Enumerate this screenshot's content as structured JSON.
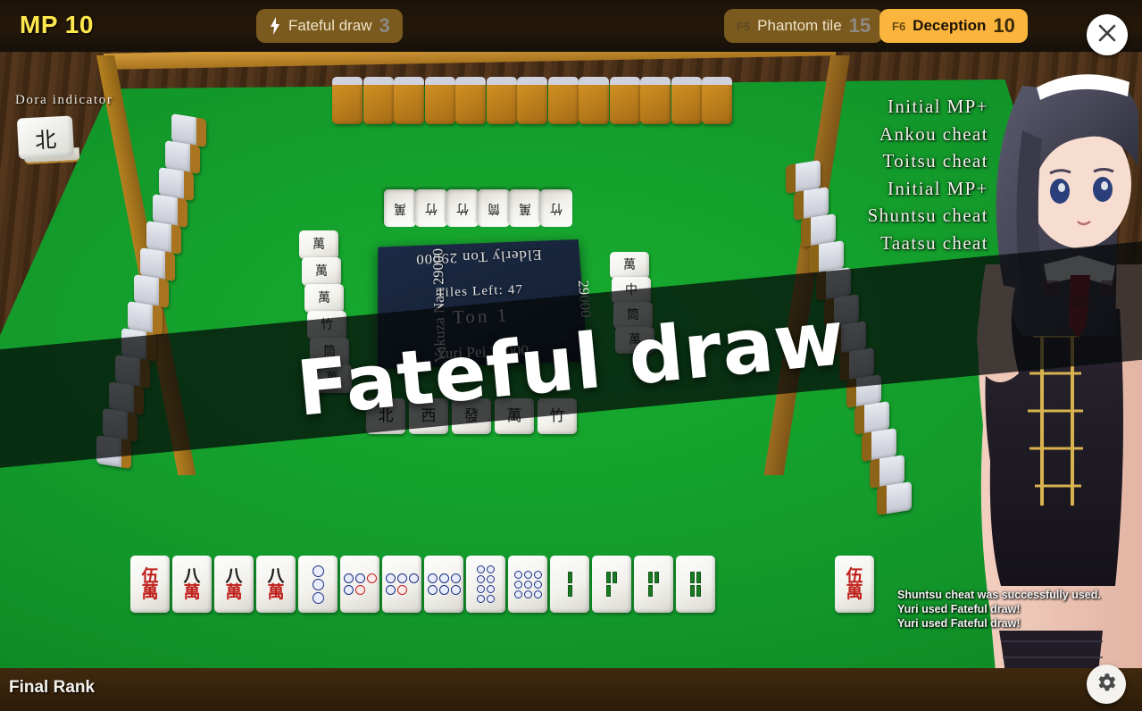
{
  "topbar": {
    "mp_label": "MP 10",
    "skills": [
      {
        "key": "",
        "name": "Fateful draw",
        "count": "3",
        "state": "dim",
        "icon": "lightning-bolt-icon"
      },
      {
        "key": "F5",
        "name": "Phantom tile",
        "count": "15",
        "state": "dim",
        "icon": ""
      },
      {
        "key": "F6",
        "name": "Deception",
        "count": "10",
        "state": "lit",
        "icon": ""
      }
    ],
    "close_icon": "close-icon"
  },
  "cheat_list": [
    "Initial MP+",
    "Ankou cheat",
    "Toitsu cheat",
    "Initial MP+",
    "Shuntsu cheat",
    "Taatsu cheat"
  ],
  "dora": {
    "label": "Dora indicator",
    "tile": "北"
  },
  "center_panel": {
    "top_player": "Elderly  Ton  29000",
    "left_player": "Yakuza  Nan  29000",
    "right_player": "29000",
    "bottom_player": "Yuri  Pei  29000",
    "tiles_left": "Tiles Left: 47",
    "round": "Ton 1"
  },
  "banner": {
    "text": "Fateful draw"
  },
  "hand": {
    "tiles": [
      {
        "suit": "man",
        "value": "5",
        "red": true,
        "label": "伍萬"
      },
      {
        "suit": "man",
        "value": "8",
        "red": false,
        "label": "八萬"
      },
      {
        "suit": "man",
        "value": "8",
        "red": false,
        "label": "八萬"
      },
      {
        "suit": "man",
        "value": "8",
        "red": false,
        "label": "八萬"
      },
      {
        "suit": "pin",
        "value": "3",
        "red": false,
        "label": "3 pin"
      },
      {
        "suit": "pin",
        "value": "5",
        "red": true,
        "label": "5 pin"
      },
      {
        "suit": "pin",
        "value": "5",
        "red": false,
        "label": "5 pin"
      },
      {
        "suit": "pin",
        "value": "6",
        "red": false,
        "label": "6 pin"
      },
      {
        "suit": "pin",
        "value": "8",
        "red": false,
        "label": "8 pin"
      },
      {
        "suit": "pin",
        "value": "9",
        "red": false,
        "label": "9 pin"
      },
      {
        "suit": "sou",
        "value": "2",
        "red": false,
        "label": "2 sou"
      },
      {
        "suit": "sou",
        "value": "3",
        "red": false,
        "label": "3 sou"
      },
      {
        "suit": "sou",
        "value": "3",
        "red": false,
        "label": "3 sou"
      },
      {
        "suit": "sou",
        "value": "4",
        "red": false,
        "label": "4 sou"
      }
    ],
    "drawn": {
      "suit": "man",
      "value": "5",
      "red": true,
      "label": "伍萬"
    }
  },
  "discards": {
    "self": [
      "北",
      "西",
      "發",
      "萬",
      "竹"
    ],
    "top": [
      "萬",
      "竹",
      "竹",
      "筒",
      "萬",
      "竹"
    ],
    "left": [
      "萬",
      "萬",
      "萬",
      "竹",
      "筒",
      "萬"
    ],
    "right": [
      "萬",
      "中",
      "筒",
      "萬"
    ]
  },
  "log": [
    "Shuntsu cheat was successfully used.",
    "Yuri used Fateful draw!",
    "Yuri used Fateful draw!"
  ],
  "bottombar": {
    "final_rank_label": "Final Rank",
    "gear_icon": "gear-icon"
  },
  "colors": {
    "accent_yellow": "#ffe84b",
    "skill_lit": "#fbb43c",
    "skill_dim": "#7a5a1e",
    "felt_green": "#12972a",
    "panel_navy": "#172338",
    "red_tile": "#c0211c"
  }
}
